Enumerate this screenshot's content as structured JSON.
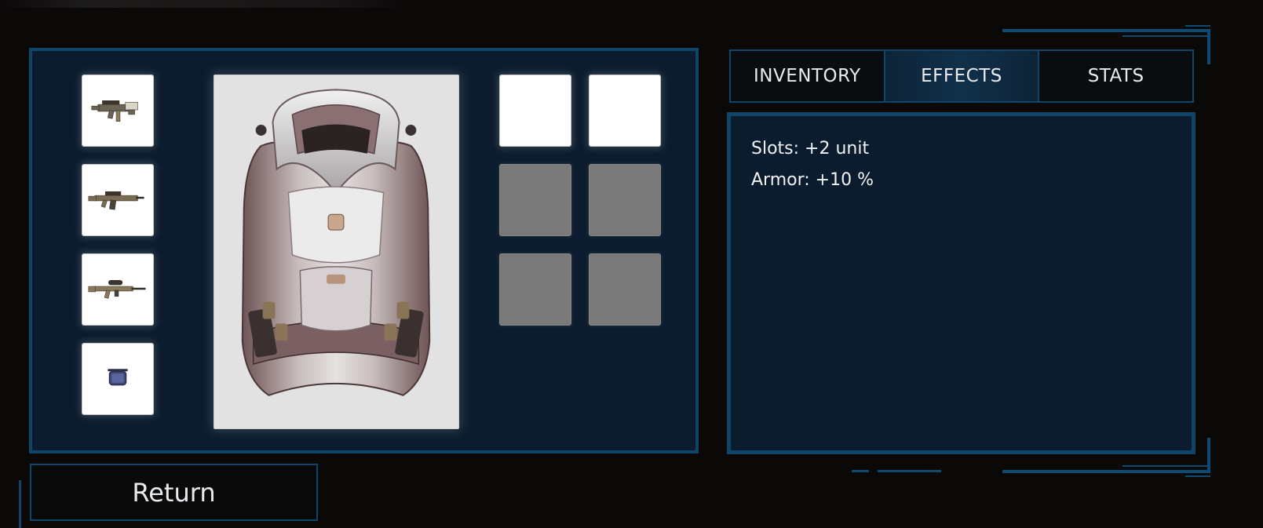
{
  "equipment": {
    "weapon_slots": [
      {
        "item": "compact smg"
      },
      {
        "item": "assault rifle"
      },
      {
        "item": "scoped rifle"
      },
      {
        "item": "small device"
      }
    ],
    "selected_item": "armored vest",
    "attachment_slots": [
      "empty",
      "empty",
      "locked",
      "locked",
      "locked",
      "locked"
    ]
  },
  "tabs": [
    {
      "label": "INVENTORY",
      "active": false
    },
    {
      "label": "EFFECTS",
      "active": true
    },
    {
      "label": "STATS",
      "active": false
    }
  ],
  "effects": [
    "Slots: +2 unit",
    "Armor: +10 %"
  ],
  "return_label": "Return",
  "colors": {
    "background": "#0b0908",
    "panel": "#0b1c2e",
    "accent_border": "#0f4568",
    "slot_locked": "#7a7a7a"
  }
}
